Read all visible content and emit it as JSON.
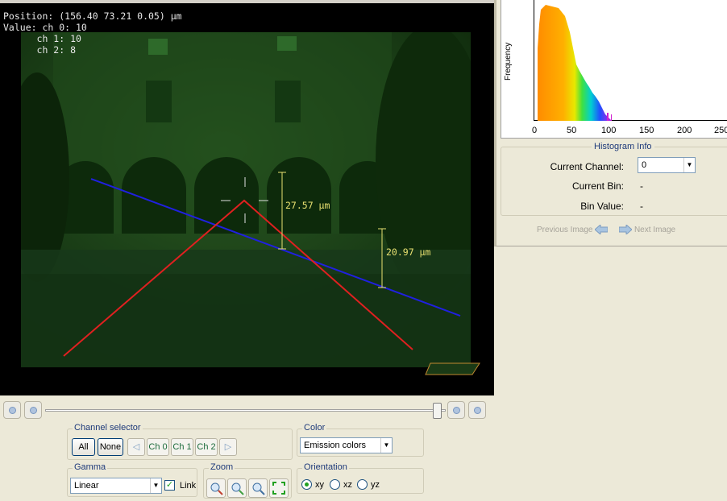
{
  "overlay": {
    "position_line": "Position: (156.40 73.21 0.05) µm",
    "value_line": "Value: ch 0: 10",
    "ch1_line": "      ch 1: 10",
    "ch2_line": "      ch 2: 8"
  },
  "measurements": [
    "27.57 µm",
    "20.97 µm"
  ],
  "colors": {
    "line_blue": "#2020e0",
    "line_red": "#e02020",
    "measure_yellow": "#e8e070"
  },
  "histogram": {
    "ylabel": "Frequency",
    "ticks": [
      "0",
      "50",
      "100",
      "150",
      "200",
      "250"
    ]
  },
  "histogram_info": {
    "title": "Histogram Info",
    "current_channel_label": "Current Channel:",
    "current_channel_value": "0",
    "current_bin_label": "Current Bin:",
    "current_bin_value": "-",
    "bin_value_label": "Bin Value:",
    "bin_value_value": "-"
  },
  "navigation": {
    "previous": "Previous Image",
    "next": "Next Image"
  },
  "slider": {
    "value": 0.99
  },
  "channel_selector": {
    "title": "Channel selector",
    "all": "All",
    "none": "None",
    "channels": [
      "Ch 0",
      "Ch 1",
      "Ch 2"
    ]
  },
  "color": {
    "title": "Color",
    "selected": "Emission colors"
  },
  "gamma": {
    "title": "Gamma",
    "selected": "Linear",
    "link_label": "Link",
    "link_checked": true
  },
  "zoom": {
    "title": "Zoom",
    "icons": [
      "zoom-out-icon",
      "zoom-in-icon",
      "zoom-reset-icon",
      "zoom-fit-icon"
    ]
  },
  "orientation": {
    "title": "Orientation",
    "options": [
      "xy",
      "xz",
      "yz"
    ],
    "selected": "xy"
  }
}
